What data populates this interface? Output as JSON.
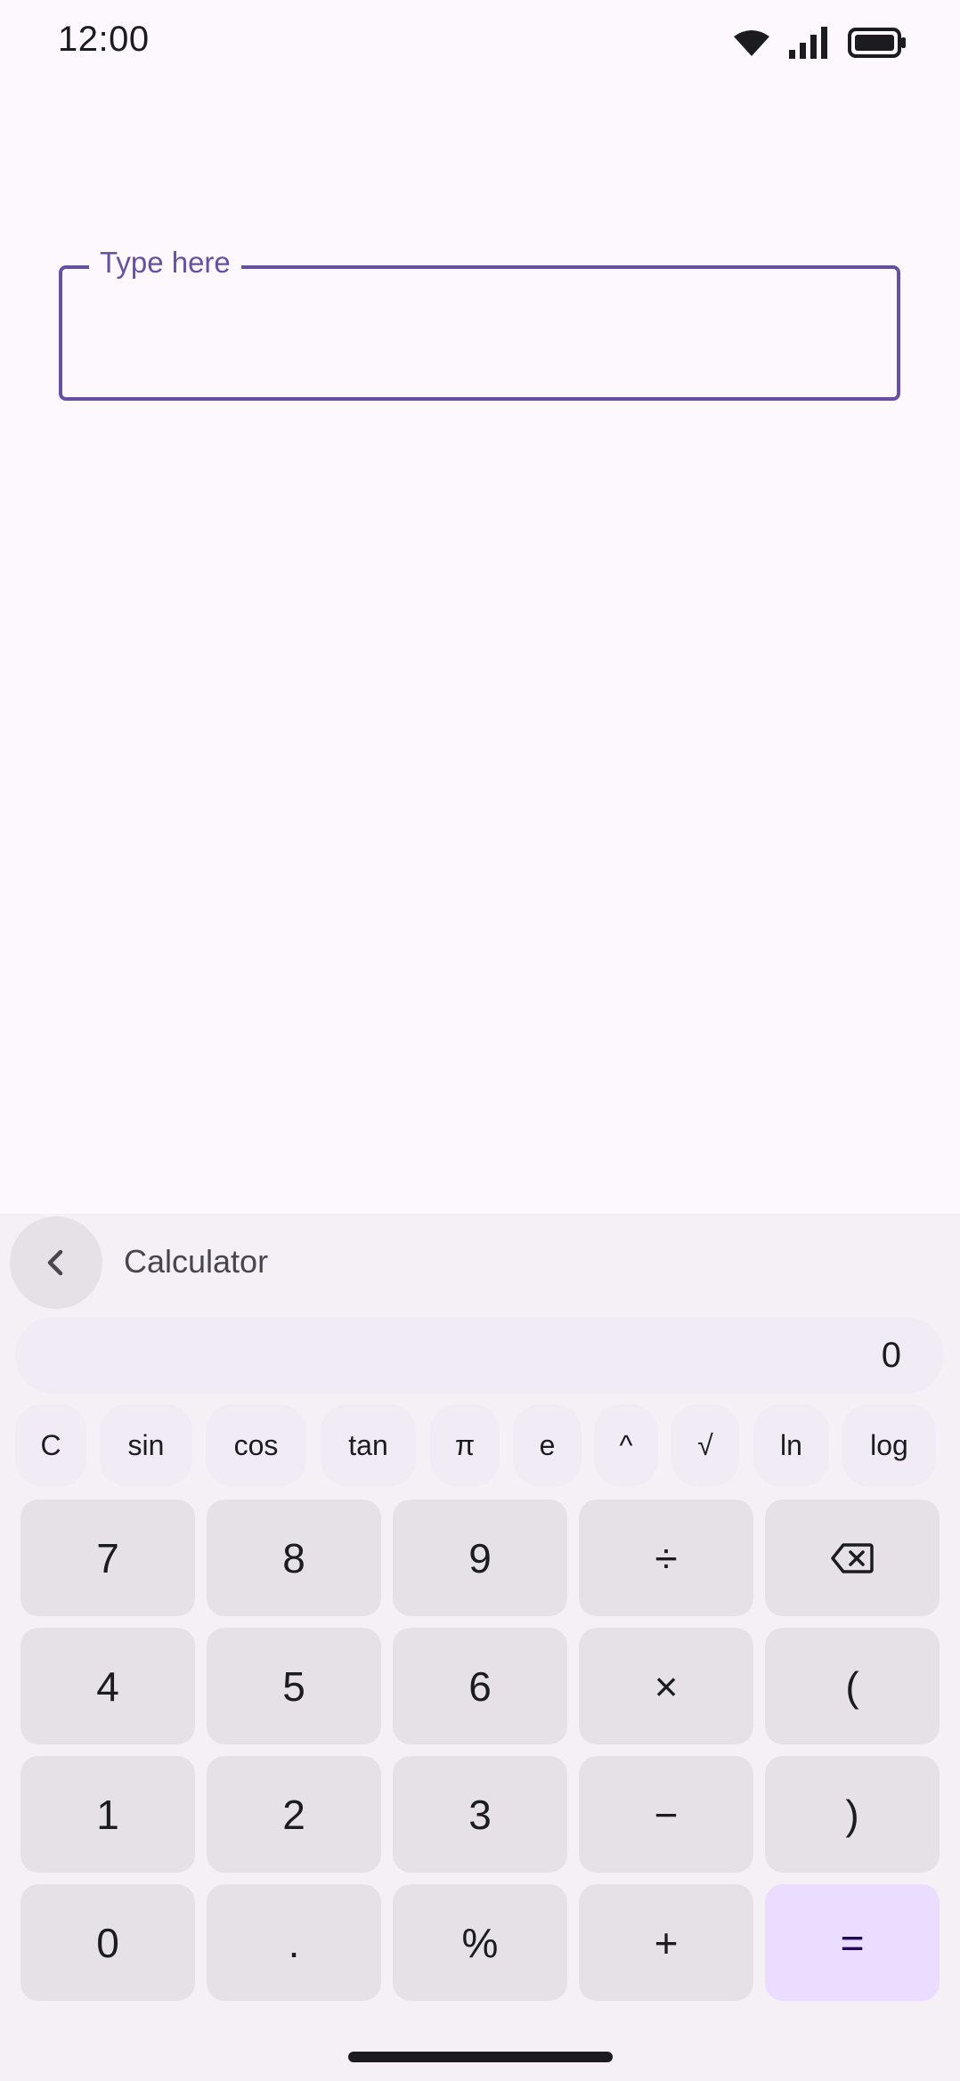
{
  "status_bar": {
    "time": "12:00",
    "icons": [
      "wifi-icon",
      "cellular-signal-icon",
      "battery-icon"
    ]
  },
  "input": {
    "label": "Type here",
    "value": ""
  },
  "keyboard": {
    "title": "Calculator",
    "back_icon": "chevron-left-icon",
    "display": "0",
    "functions": [
      "C",
      "sin",
      "cos",
      "tan",
      "π",
      "e",
      "^",
      "√",
      "ln",
      "log"
    ],
    "rows": [
      [
        "7",
        "8",
        "9",
        "÷",
        "⌫"
      ],
      [
        "4",
        "5",
        "6",
        "×",
        "("
      ],
      [
        "1",
        "2",
        "3",
        "−",
        ")"
      ],
      [
        "0",
        ".",
        "%",
        "+",
        "="
      ]
    ]
  },
  "colors": {
    "background": "#fdf8fd",
    "accent": "#6750a4",
    "key": "#e6e1e7",
    "equals_key": "#eaddff"
  }
}
